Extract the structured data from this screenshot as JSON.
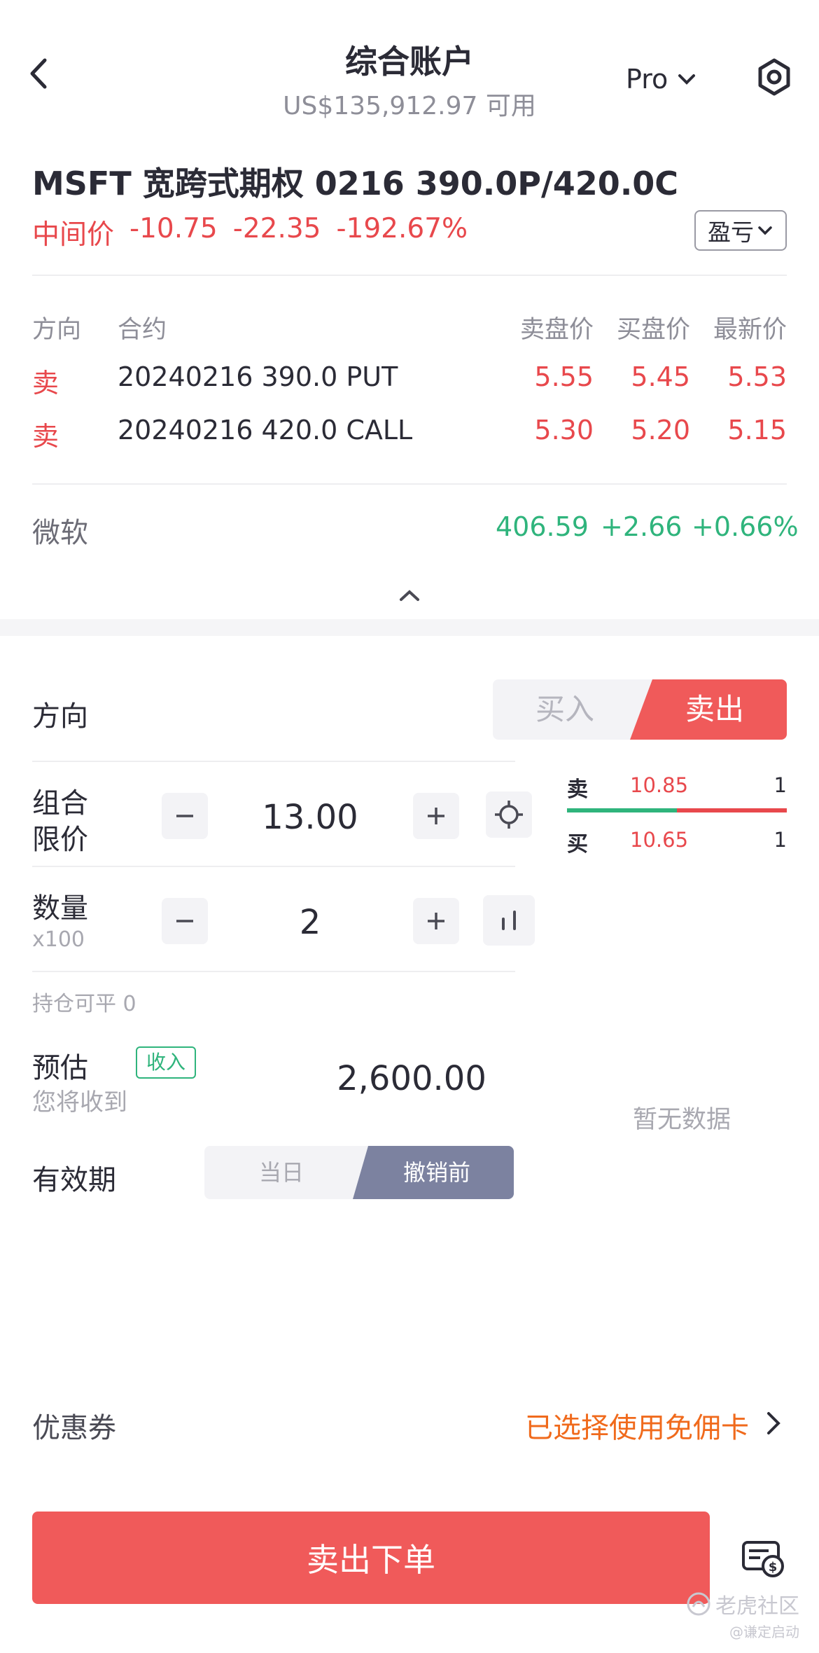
{
  "header": {
    "title": "综合账户",
    "balance": "US$135,912.97 可用",
    "mode": "Pro"
  },
  "strategy": {
    "name": "MSFT 宽跨式期权 0216 390.0P/420.0C",
    "mid_label": "中间价",
    "mid_price": "-10.75",
    "change": "-22.35",
    "change_pct": "-192.67%",
    "pnl_button": "盈亏"
  },
  "legs_table": {
    "headers": {
      "direction": "方向",
      "contract": "合约",
      "ask": "卖盘价",
      "bid": "买盘价",
      "last": "最新价"
    },
    "rows": [
      {
        "direction": "卖",
        "contract": "20240216 390.0 PUT",
        "ask": "5.55",
        "bid": "5.45",
        "last": "5.53"
      },
      {
        "direction": "卖",
        "contract": "20240216 420.0 CALL",
        "ask": "5.30",
        "bid": "5.20",
        "last": "5.15"
      }
    ]
  },
  "underlying": {
    "name": "微软",
    "price": "406.59",
    "change": "+2.66",
    "change_pct": "+0.66%"
  },
  "order": {
    "direction_label": "方向",
    "buy": "买入",
    "sell": "卖出",
    "limit_label_1": "组合",
    "limit_label_2": "限价",
    "limit_price": "13.00",
    "qty_label": "数量",
    "qty_unit": "x100",
    "quantity": "2",
    "position_closable": "持仓可平 0",
    "estimate_label": "预估",
    "estimate_sub": "您将收到",
    "income_badge": "收入",
    "estimate_value": "2,600.00",
    "validity_label": "有效期",
    "validity_day": "当日",
    "validity_gtc": "撤销前"
  },
  "orderbook": {
    "ask_label": "卖",
    "ask_price": "10.85",
    "ask_size": "1",
    "bid_label": "买",
    "bid_price": "10.65",
    "bid_size": "1",
    "bid_ratio": 0.5,
    "no_data": "暂无数据"
  },
  "coupon": {
    "label": "优惠券",
    "value": "已选择使用免佣卡"
  },
  "submit": {
    "label": "卖出下单"
  },
  "watermark": {
    "brand": "老虎社区",
    "handle": "@谦定启动"
  },
  "colors": {
    "accent_red": "#f05a5a",
    "up_green": "#2fb47c",
    "down_red": "#e8484c",
    "gtc_slate": "#7c82a0",
    "coupon_orange": "#f06a1c"
  }
}
